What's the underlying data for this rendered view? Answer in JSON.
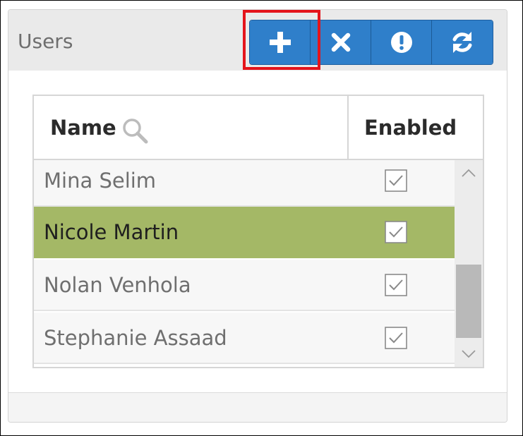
{
  "panel": {
    "title": "Users"
  },
  "toolbar": {
    "buttons": [
      {
        "icon": "plus-icon",
        "action": "add"
      },
      {
        "icon": "close-icon",
        "action": "delete"
      },
      {
        "icon": "exclamation-icon",
        "action": "alert"
      },
      {
        "icon": "refresh-icon",
        "action": "refresh"
      }
    ],
    "highlighted_button": "add",
    "highlight_color": "#e4141b",
    "button_color": "#2f7fca"
  },
  "grid": {
    "columns": [
      "Name",
      "Enabled"
    ],
    "rows": [
      {
        "name": "Mina Selim",
        "enabled": true,
        "selected": false
      },
      {
        "name": "Nicole Martin",
        "enabled": true,
        "selected": true
      },
      {
        "name": "Nolan Venhola",
        "enabled": true,
        "selected": false
      },
      {
        "name": "Stephanie Assaad",
        "enabled": true,
        "selected": false
      }
    ],
    "selected_row_color": "#a4b866",
    "scroll_position": 0.55
  }
}
